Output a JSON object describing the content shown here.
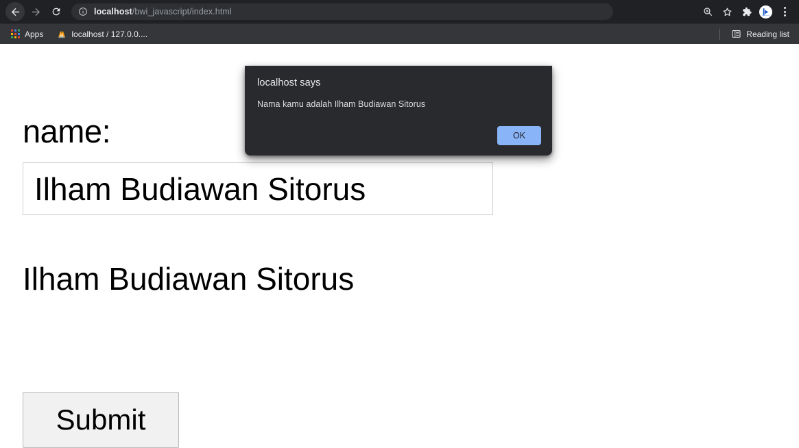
{
  "browser": {
    "nav": {
      "back_icon": "arrow-left-icon",
      "forward_icon": "arrow-right-icon",
      "reload_icon": "reload-icon"
    },
    "omnibox": {
      "security_icon": "info-circle-icon",
      "host": "localhost",
      "path": "/bwi_javascript/index.html",
      "full_url": "localhost/bwi_javascript/index.html"
    },
    "toolbar_right": {
      "zoom_icon": "zoom-search-icon",
      "bookmark_icon": "star-icon",
      "extensions_icon": "puzzle-piece-icon",
      "profile_icon": "profile-avatar-icon",
      "menu_icon": "three-dot-menu-icon"
    },
    "bookmarks": {
      "items": [
        {
          "label": "Apps",
          "icon": "apps-grid-icon"
        },
        {
          "label": "localhost / 127.0.0....",
          "icon": "phpmyadmin-icon"
        }
      ],
      "reading_list": {
        "label": "Reading list",
        "icon": "reading-list-icon"
      }
    }
  },
  "page": {
    "name_label": "name:",
    "name_input_value": "Ilham Budiawan Sitorus",
    "name_input_placeholder": "",
    "result_heading": "Ilham Budiawan Sitorus",
    "submit_label": "Submit"
  },
  "dialog": {
    "title": "localhost says",
    "message": "Nama kamu adalah Ilham Budiawan Sitorus",
    "ok_label": "OK"
  },
  "colors": {
    "toolbar_bg": "#202124",
    "bookmarks_bg": "#35363a",
    "omnibox_bg": "#2f3034",
    "dialog_bg": "#292a2d",
    "dialog_accent": "#8ab4f8",
    "page_bg": "#ffffff",
    "text_light": "#e8eaed"
  }
}
